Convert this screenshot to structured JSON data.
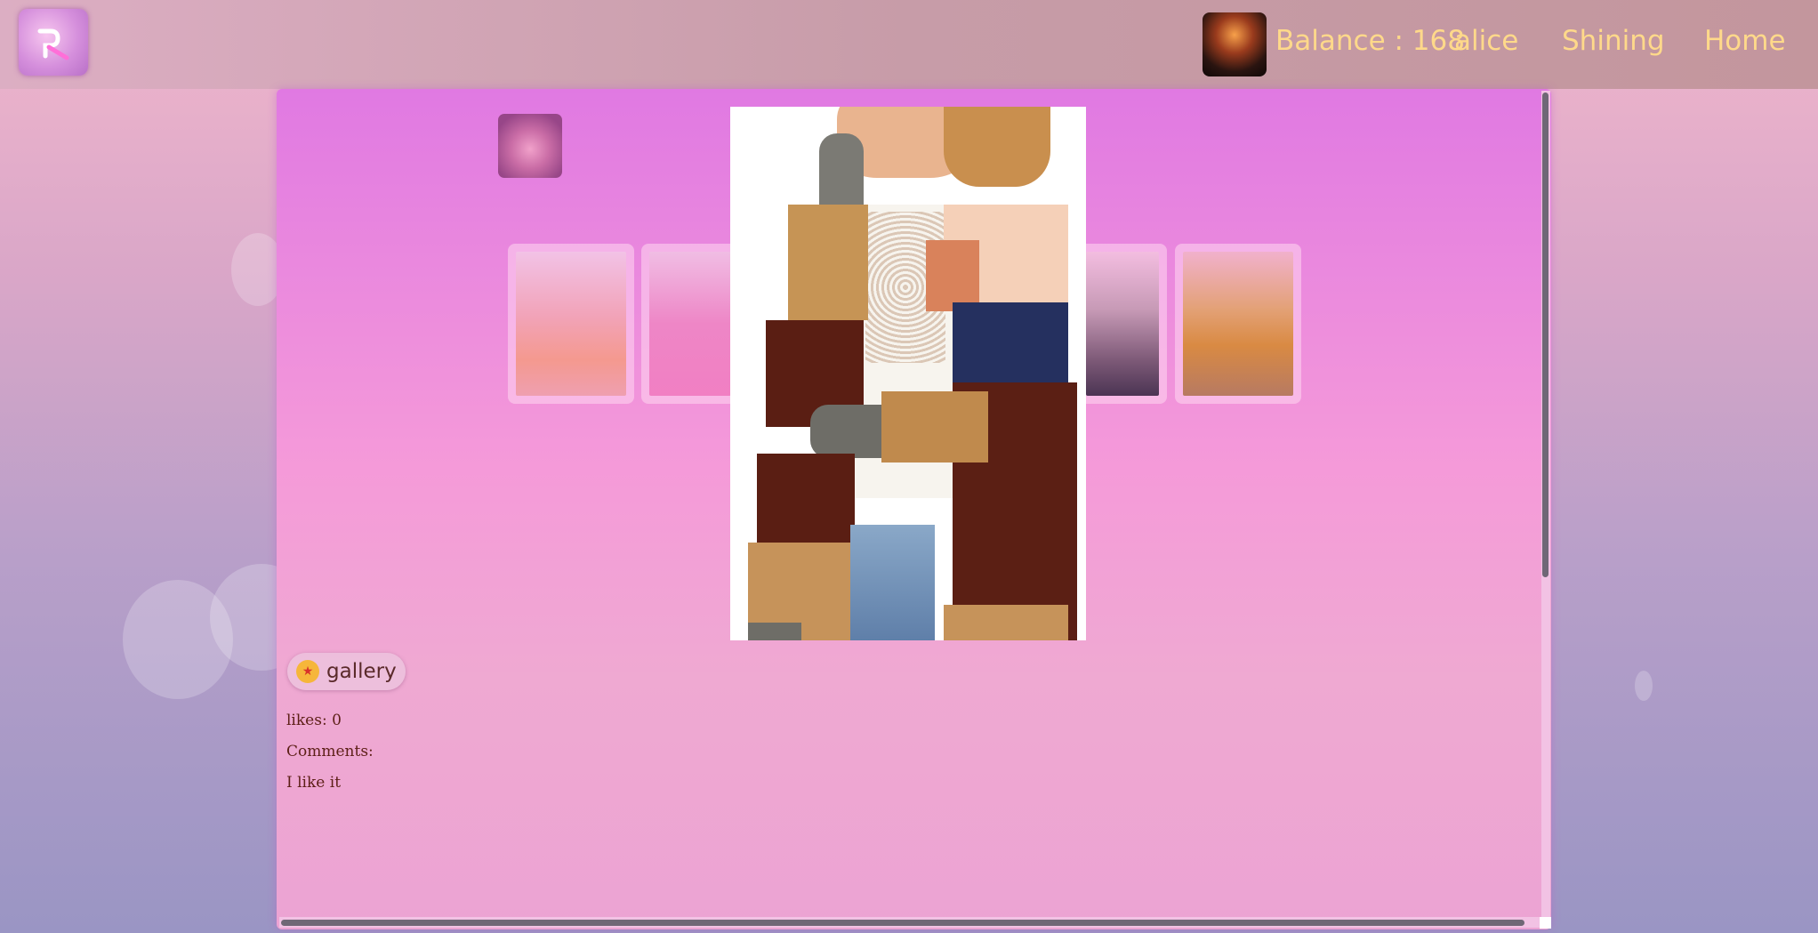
{
  "header": {
    "balance_text": "Balance : 168",
    "user_name": "alice",
    "nav_shining": "Shining",
    "nav_home": "Home"
  },
  "icons": {
    "logo": "app-logo-icon",
    "avatar": "user-avatar-icon",
    "small": "strawberry-icon"
  },
  "gallery": {
    "button_label": "gallery",
    "emoji": "star-struck-emoji"
  },
  "post": {
    "likes_text": "likes: 0",
    "comments_label": "Comments:",
    "comments": [
      "I like it"
    ]
  },
  "colors": {
    "accent_text": "#ffd98a",
    "panel_top": "#e079e2",
    "panel_bottom": "#eca3d3",
    "info_text": "#5c1f16"
  }
}
